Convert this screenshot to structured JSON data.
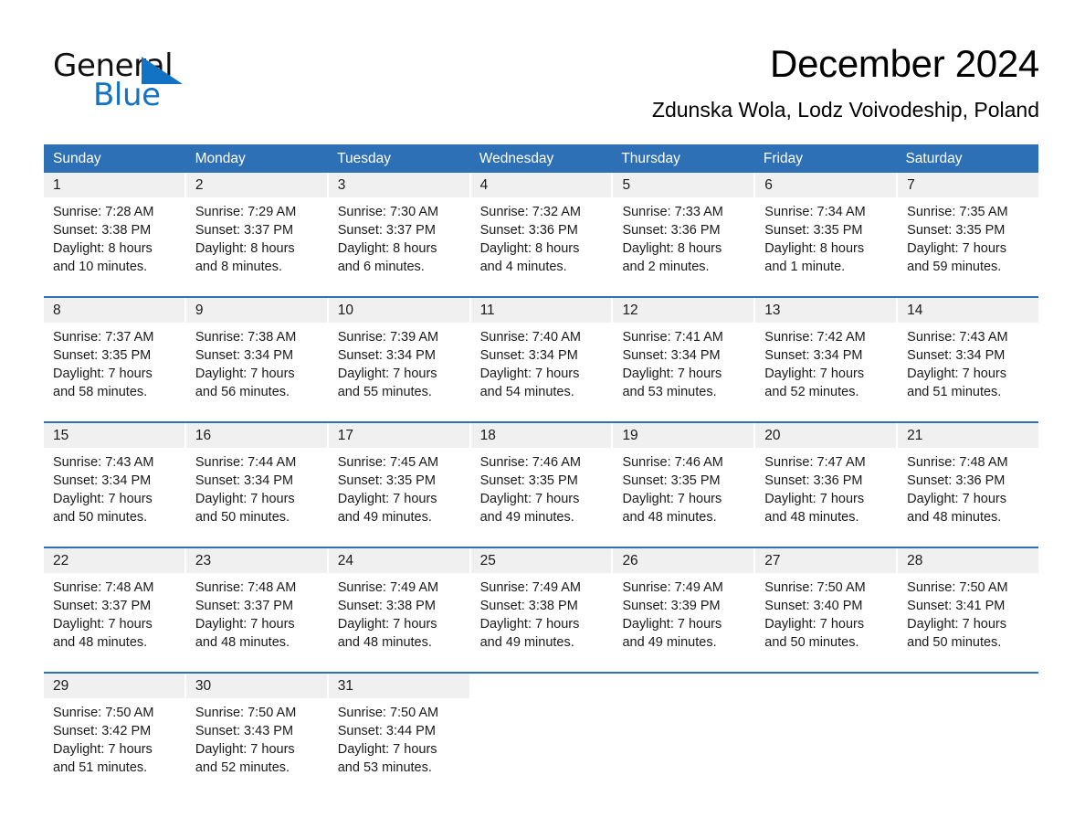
{
  "brand": {
    "name_part1": "General",
    "name_part2": "Blue",
    "accent_color": "#1272c4",
    "triangle_icon": "brand-triangle-icon"
  },
  "header": {
    "title": "December 2024",
    "subtitle": "Zdunska Wola, Lodz Voivodeship, Poland"
  },
  "calendar": {
    "header_bg": "#2e70b5",
    "daynum_bg": "#f0f0f0",
    "weekday_names": [
      "Sunday",
      "Monday",
      "Tuesday",
      "Wednesday",
      "Thursday",
      "Friday",
      "Saturday"
    ],
    "weeks": [
      [
        {
          "day": "1",
          "sunrise": "Sunrise: 7:28 AM",
          "sunset": "Sunset: 3:38 PM",
          "daylight_line1": "Daylight: 8 hours",
          "daylight_line2": "and 10 minutes."
        },
        {
          "day": "2",
          "sunrise": "Sunrise: 7:29 AM",
          "sunset": "Sunset: 3:37 PM",
          "daylight_line1": "Daylight: 8 hours",
          "daylight_line2": "and 8 minutes."
        },
        {
          "day": "3",
          "sunrise": "Sunrise: 7:30 AM",
          "sunset": "Sunset: 3:37 PM",
          "daylight_line1": "Daylight: 8 hours",
          "daylight_line2": "and 6 minutes."
        },
        {
          "day": "4",
          "sunrise": "Sunrise: 7:32 AM",
          "sunset": "Sunset: 3:36 PM",
          "daylight_line1": "Daylight: 8 hours",
          "daylight_line2": "and 4 minutes."
        },
        {
          "day": "5",
          "sunrise": "Sunrise: 7:33 AM",
          "sunset": "Sunset: 3:36 PM",
          "daylight_line1": "Daylight: 8 hours",
          "daylight_line2": "and 2 minutes."
        },
        {
          "day": "6",
          "sunrise": "Sunrise: 7:34 AM",
          "sunset": "Sunset: 3:35 PM",
          "daylight_line1": "Daylight: 8 hours",
          "daylight_line2": "and 1 minute."
        },
        {
          "day": "7",
          "sunrise": "Sunrise: 7:35 AM",
          "sunset": "Sunset: 3:35 PM",
          "daylight_line1": "Daylight: 7 hours",
          "daylight_line2": "and 59 minutes."
        }
      ],
      [
        {
          "day": "8",
          "sunrise": "Sunrise: 7:37 AM",
          "sunset": "Sunset: 3:35 PM",
          "daylight_line1": "Daylight: 7 hours",
          "daylight_line2": "and 58 minutes."
        },
        {
          "day": "9",
          "sunrise": "Sunrise: 7:38 AM",
          "sunset": "Sunset: 3:34 PM",
          "daylight_line1": "Daylight: 7 hours",
          "daylight_line2": "and 56 minutes."
        },
        {
          "day": "10",
          "sunrise": "Sunrise: 7:39 AM",
          "sunset": "Sunset: 3:34 PM",
          "daylight_line1": "Daylight: 7 hours",
          "daylight_line2": "and 55 minutes."
        },
        {
          "day": "11",
          "sunrise": "Sunrise: 7:40 AM",
          "sunset": "Sunset: 3:34 PM",
          "daylight_line1": "Daylight: 7 hours",
          "daylight_line2": "and 54 minutes."
        },
        {
          "day": "12",
          "sunrise": "Sunrise: 7:41 AM",
          "sunset": "Sunset: 3:34 PM",
          "daylight_line1": "Daylight: 7 hours",
          "daylight_line2": "and 53 minutes."
        },
        {
          "day": "13",
          "sunrise": "Sunrise: 7:42 AM",
          "sunset": "Sunset: 3:34 PM",
          "daylight_line1": "Daylight: 7 hours",
          "daylight_line2": "and 52 minutes."
        },
        {
          "day": "14",
          "sunrise": "Sunrise: 7:43 AM",
          "sunset": "Sunset: 3:34 PM",
          "daylight_line1": "Daylight: 7 hours",
          "daylight_line2": "and 51 minutes."
        }
      ],
      [
        {
          "day": "15",
          "sunrise": "Sunrise: 7:43 AM",
          "sunset": "Sunset: 3:34 PM",
          "daylight_line1": "Daylight: 7 hours",
          "daylight_line2": "and 50 minutes."
        },
        {
          "day": "16",
          "sunrise": "Sunrise: 7:44 AM",
          "sunset": "Sunset: 3:34 PM",
          "daylight_line1": "Daylight: 7 hours",
          "daylight_line2": "and 50 minutes."
        },
        {
          "day": "17",
          "sunrise": "Sunrise: 7:45 AM",
          "sunset": "Sunset: 3:35 PM",
          "daylight_line1": "Daylight: 7 hours",
          "daylight_line2": "and 49 minutes."
        },
        {
          "day": "18",
          "sunrise": "Sunrise: 7:46 AM",
          "sunset": "Sunset: 3:35 PM",
          "daylight_line1": "Daylight: 7 hours",
          "daylight_line2": "and 49 minutes."
        },
        {
          "day": "19",
          "sunrise": "Sunrise: 7:46 AM",
          "sunset": "Sunset: 3:35 PM",
          "daylight_line1": "Daylight: 7 hours",
          "daylight_line2": "and 48 minutes."
        },
        {
          "day": "20",
          "sunrise": "Sunrise: 7:47 AM",
          "sunset": "Sunset: 3:36 PM",
          "daylight_line1": "Daylight: 7 hours",
          "daylight_line2": "and 48 minutes."
        },
        {
          "day": "21",
          "sunrise": "Sunrise: 7:48 AM",
          "sunset": "Sunset: 3:36 PM",
          "daylight_line1": "Daylight: 7 hours",
          "daylight_line2": "and 48 minutes."
        }
      ],
      [
        {
          "day": "22",
          "sunrise": "Sunrise: 7:48 AM",
          "sunset": "Sunset: 3:37 PM",
          "daylight_line1": "Daylight: 7 hours",
          "daylight_line2": "and 48 minutes."
        },
        {
          "day": "23",
          "sunrise": "Sunrise: 7:48 AM",
          "sunset": "Sunset: 3:37 PM",
          "daylight_line1": "Daylight: 7 hours",
          "daylight_line2": "and 48 minutes."
        },
        {
          "day": "24",
          "sunrise": "Sunrise: 7:49 AM",
          "sunset": "Sunset: 3:38 PM",
          "daylight_line1": "Daylight: 7 hours",
          "daylight_line2": "and 48 minutes."
        },
        {
          "day": "25",
          "sunrise": "Sunrise: 7:49 AM",
          "sunset": "Sunset: 3:38 PM",
          "daylight_line1": "Daylight: 7 hours",
          "daylight_line2": "and 49 minutes."
        },
        {
          "day": "26",
          "sunrise": "Sunrise: 7:49 AM",
          "sunset": "Sunset: 3:39 PM",
          "daylight_line1": "Daylight: 7 hours",
          "daylight_line2": "and 49 minutes."
        },
        {
          "day": "27",
          "sunrise": "Sunrise: 7:50 AM",
          "sunset": "Sunset: 3:40 PM",
          "daylight_line1": "Daylight: 7 hours",
          "daylight_line2": "and 50 minutes."
        },
        {
          "day": "28",
          "sunrise": "Sunrise: 7:50 AM",
          "sunset": "Sunset: 3:41 PM",
          "daylight_line1": "Daylight: 7 hours",
          "daylight_line2": "and 50 minutes."
        }
      ],
      [
        {
          "day": "29",
          "sunrise": "Sunrise: 7:50 AM",
          "sunset": "Sunset: 3:42 PM",
          "daylight_line1": "Daylight: 7 hours",
          "daylight_line2": "and 51 minutes."
        },
        {
          "day": "30",
          "sunrise": "Sunrise: 7:50 AM",
          "sunset": "Sunset: 3:43 PM",
          "daylight_line1": "Daylight: 7 hours",
          "daylight_line2": "and 52 minutes."
        },
        {
          "day": "31",
          "sunrise": "Sunrise: 7:50 AM",
          "sunset": "Sunset: 3:44 PM",
          "daylight_line1": "Daylight: 7 hours",
          "daylight_line2": "and 53 minutes."
        },
        {
          "day": "",
          "sunrise": "",
          "sunset": "",
          "daylight_line1": "",
          "daylight_line2": ""
        },
        {
          "day": "",
          "sunrise": "",
          "sunset": "",
          "daylight_line1": "",
          "daylight_line2": ""
        },
        {
          "day": "",
          "sunrise": "",
          "sunset": "",
          "daylight_line1": "",
          "daylight_line2": ""
        },
        {
          "day": "",
          "sunrise": "",
          "sunset": "",
          "daylight_line1": "",
          "daylight_line2": ""
        }
      ]
    ]
  }
}
